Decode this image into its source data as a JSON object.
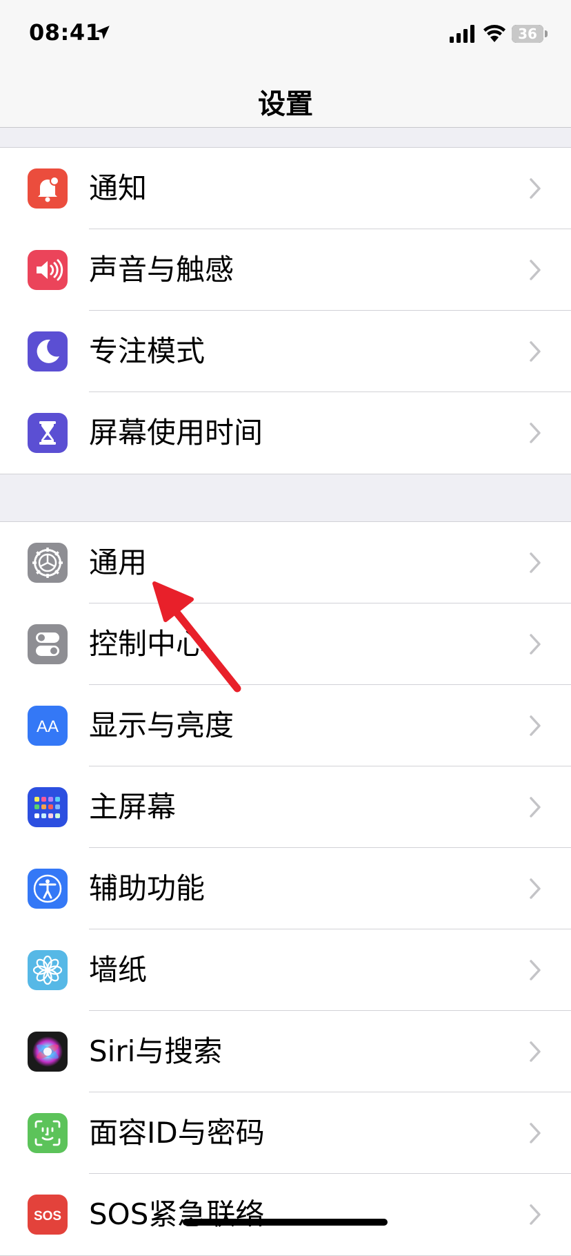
{
  "status_bar": {
    "time": "08:41",
    "battery_level": "36",
    "icons": [
      "location-arrow-icon",
      "cellular-signal-icon",
      "wifi-icon",
      "battery-icon"
    ]
  },
  "nav": {
    "title": "设置"
  },
  "groups": [
    {
      "items": [
        {
          "label": "通知",
          "icon": "notifications-icon",
          "color": "#eb4d3d"
        },
        {
          "label": "声音与触感",
          "icon": "sounds-icon",
          "color": "#eb445a"
        },
        {
          "label": "专注模式",
          "icon": "focus-moon-icon",
          "color": "#5b4fd3"
        },
        {
          "label": "屏幕使用时间",
          "icon": "screen-time-hourglass-icon",
          "color": "#5b4fd3"
        }
      ]
    },
    {
      "items": [
        {
          "label": "通用",
          "icon": "general-gear-icon",
          "color": "#8e8e93"
        },
        {
          "label": "控制中心",
          "icon": "control-center-icon",
          "color": "#8e8e93"
        },
        {
          "label": "显示与亮度",
          "icon": "display-brightness-icon",
          "color": "#3478f6"
        },
        {
          "label": "主屏幕",
          "icon": "home-screen-icon",
          "color": "#2c4fe0"
        },
        {
          "label": "辅助功能",
          "icon": "accessibility-icon",
          "color": "#3478f6"
        },
        {
          "label": "墙纸",
          "icon": "wallpaper-flower-icon",
          "color": "#56b8e6"
        },
        {
          "label": "Siri与搜索",
          "icon": "siri-icon",
          "color": "#222222"
        },
        {
          "label": "面容ID与密码",
          "icon": "face-id-icon",
          "color": "#5cc35a"
        },
        {
          "label": "SOS紧急联络",
          "icon": "sos-icon",
          "color": "#e3423b"
        }
      ]
    }
  ],
  "icon_text": {
    "display": "AA",
    "sos": "SOS"
  },
  "annotation": {
    "color": "#e8202a",
    "target": "通用"
  }
}
